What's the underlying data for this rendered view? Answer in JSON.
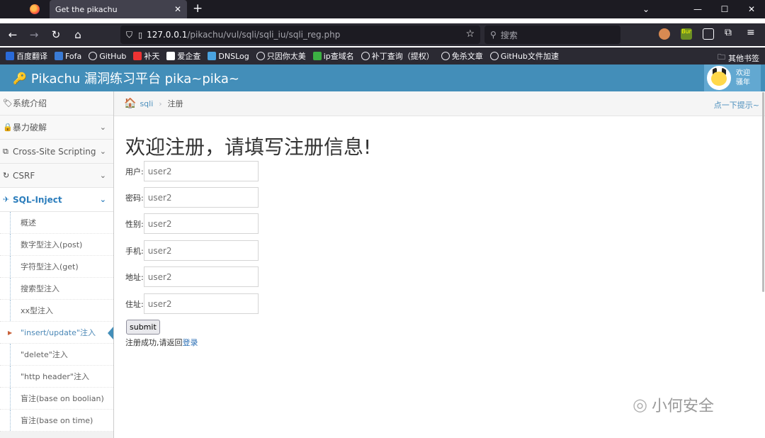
{
  "browser": {
    "tab_title": "Get the pikachu",
    "tab_close": "✕",
    "new_tab": "+",
    "url_host": "127.0.0.1",
    "url_path": "/pikachu/vul/sqli/sqli_iu/sqli_reg.php",
    "search_placeholder": "搜索",
    "extension_label": "Bur"
  },
  "bookmarks": [
    {
      "label": "百度翻译",
      "icon": "translate-icon"
    },
    {
      "label": "Fofa",
      "icon": "fofa-icon"
    },
    {
      "label": "GitHub",
      "icon": "github-icon"
    },
    {
      "label": "补天",
      "icon": "butian-icon"
    },
    {
      "label": "爱企查",
      "icon": "aiqicha-icon"
    },
    {
      "label": "DNSLog",
      "icon": "dnslog-icon"
    },
    {
      "label": "只因你太美",
      "icon": "globe-icon"
    },
    {
      "label": "ip查域名",
      "icon": "ip-icon"
    },
    {
      "label": "补丁查询（提权）",
      "icon": "globe-icon"
    },
    {
      "label": "免杀文章",
      "icon": "github-icon"
    },
    {
      "label": "GitHub文件加速",
      "icon": "globe-icon"
    }
  ],
  "bookmarks_other": "其他书签",
  "app": {
    "title": "Pikachu 漏洞练习平台 pika~pika~",
    "user_line1": "欢迎",
    "user_line2": "骚年"
  },
  "sidebar": {
    "items": [
      {
        "label": "系统介绍"
      },
      {
        "label": "暴力破解"
      },
      {
        "label": "Cross-Site Scripting"
      },
      {
        "label": "CSRF"
      },
      {
        "label": "SQL-Inject"
      }
    ],
    "sub_items": [
      {
        "label": "概述"
      },
      {
        "label": "数字型注入(post)"
      },
      {
        "label": "字符型注入(get)"
      },
      {
        "label": "搜索型注入"
      },
      {
        "label": "xx型注入"
      },
      {
        "label": "\"insert/update\"注入"
      },
      {
        "label": "\"delete\"注入"
      },
      {
        "label": "\"http header\"注入"
      },
      {
        "label": "盲注(base on boolian)"
      },
      {
        "label": "盲注(base on time)"
      }
    ]
  },
  "breadcrumb": {
    "link": "sqli",
    "separator": "›",
    "current": "注册",
    "hint": "点一下提示~"
  },
  "main": {
    "heading": "欢迎注册，请填写注册信息!",
    "fields": [
      {
        "label": "用户:",
        "placeholder": "user2"
      },
      {
        "label": "密码:",
        "placeholder": "user2"
      },
      {
        "label": "性别:",
        "placeholder": "user2"
      },
      {
        "label": "手机:",
        "placeholder": "user2"
      },
      {
        "label": "地址:",
        "placeholder": "user2"
      },
      {
        "label": "住址:",
        "placeholder": "user2"
      }
    ],
    "submit_label": "submit",
    "result_text": "注册成功,请返回",
    "result_link": "登录"
  },
  "watermark": "小何安全",
  "colors": {
    "header_bg": "#438eb9",
    "link": "#4c8fbd",
    "chrome_bg": "#2b2a33"
  }
}
